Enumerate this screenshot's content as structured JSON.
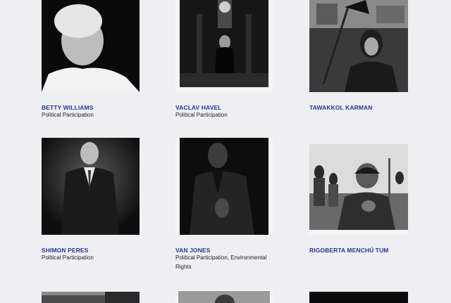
{
  "people": [
    {
      "name": "BETTY WILLIAMS",
      "category": "Political Participation"
    },
    {
      "name": "VACLAV HAVEL",
      "category": "Political Participation"
    },
    {
      "name": "TAWAKKOL KARMAN",
      "category": ""
    },
    {
      "name": "SHIMON PERES",
      "category": "Political Participation"
    },
    {
      "name": "VAN JONES",
      "category": "Political Participation, Environmental Rights"
    },
    {
      "name": "RIGOBERTA MENCHÚ TUM",
      "category": ""
    }
  ],
  "colors": {
    "background": "#efeff3",
    "name_link": "#1f3a93",
    "text": "#222222"
  }
}
